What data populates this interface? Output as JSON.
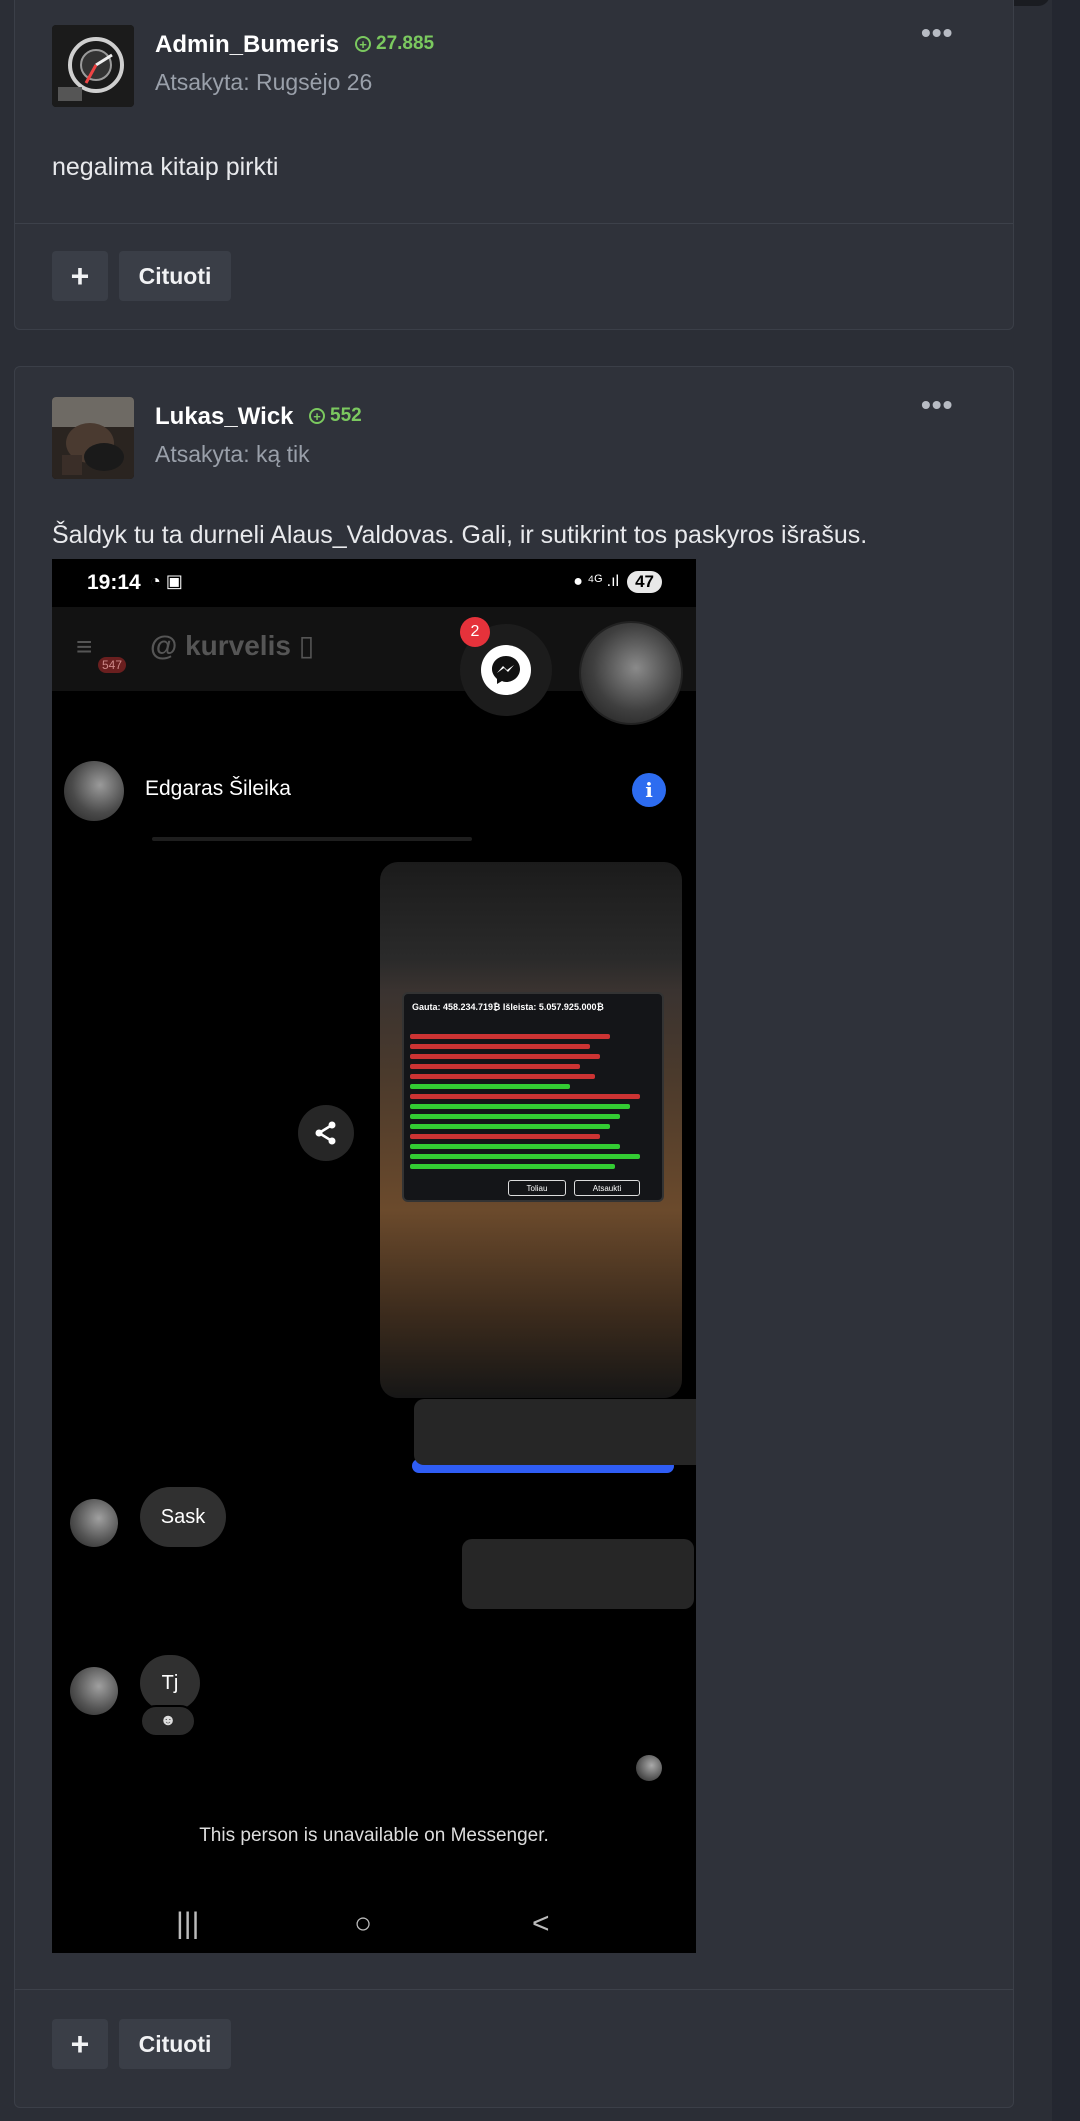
{
  "posts": [
    {
      "username": "Admin_Bumeris",
      "reputation": "27.885",
      "meta": "Atsakyta: Rugsėjo 26",
      "text": "negalima kitaip pirkti",
      "actions": {
        "add_label": "+",
        "quote_label": "Cituoti"
      }
    },
    {
      "username": "Lukas_Wick",
      "reputation": "552",
      "meta": "Atsakyta: ką tik",
      "text": "Šaldyk tu ta durneli Alaus_Valdovas. Gali, ir sutikrint tos paskyros išrašus.",
      "actions": {
        "add_label": "+",
        "quote_label": "Cituoti"
      },
      "attachment": {
        "status_time": "19:14",
        "status_icons": "◔ ▣",
        "status_right": "● ⁴ᴳ .ıl",
        "battery": "47",
        "app_badge": "547",
        "app_name": "@ kurvelis ▯",
        "messenger_count": "2",
        "chat_contact": "Edgaras Šileika",
        "info_glyph": "i",
        "game_header": "Gauta: 458.234.719₿  Išleista: 5.057.925.000₿",
        "game_btn_left": "Toliau",
        "game_btn_right": "Atsaukti",
        "messages": [
          "Sask",
          "Tj"
        ],
        "unavailable_text": "This person is unavailable on Messenger.",
        "nav": [
          "|||",
          "○",
          "<"
        ]
      }
    }
  ],
  "icons": {
    "more": "more-options-icon",
    "rep": "reputation-plus-icon",
    "share": "share-icon",
    "messenger": "messenger-icon",
    "info": "info-icon"
  },
  "colors": {
    "background": "#2b2e36",
    "card": "#2f323a",
    "reputation": "#7bc95f",
    "messenger_blue": "#2f5df5"
  }
}
